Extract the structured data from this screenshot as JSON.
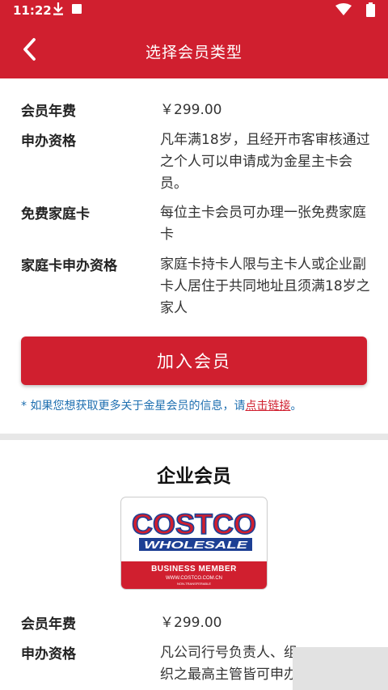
{
  "status_bar": {
    "time": "11:22"
  },
  "header": {
    "title": "选择会员类型"
  },
  "membership": {
    "rows": [
      {
        "label": "会员年费",
        "value": "￥299.00"
      },
      {
        "label": "申办资格",
        "value": "凡年满18岁，且经开市客审核通过之个人可以申请成为金星主卡会员。"
      },
      {
        "label": "免费家庭卡",
        "value": "每位主卡会员可办理一张免费家庭卡"
      },
      {
        "label": "家庭卡申办资格",
        "value": "家庭卡持卡人限与主卡人或企业副卡人居住于共同地址且须满18岁之家人"
      }
    ],
    "join_button": "加入会员",
    "note_prefix": "* 如果您想获取更多关于金星会员的信息，请",
    "note_link": "点击链接",
    "note_suffix": "。"
  },
  "business": {
    "title": "企业会员",
    "card": {
      "logo_top": "COSTCO",
      "logo_bottom": "WHOLESALE",
      "type": "BUSINESS MEMBER",
      "url": "WWW.COSTCO.COM.CN",
      "fine_print": "NON-TRANSFERABLE"
    },
    "rows": [
      {
        "label": "会员年费",
        "value": "￥299.00"
      },
      {
        "label": "申办资格",
        "value": "凡公司行号负责人、组织之最高主管皆可申办"
      }
    ]
  },
  "colors": {
    "brand_red": "#d01f2f",
    "link_blue": "#1e6fb0",
    "card_blue": "#1c3f94"
  }
}
